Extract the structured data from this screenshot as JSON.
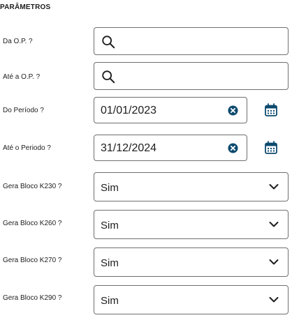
{
  "section": {
    "title": "PARÂMETROS"
  },
  "fields": [
    {
      "label": "Da O.P. ?",
      "type": "search",
      "value": ""
    },
    {
      "label": "Até a O.P. ?",
      "type": "search",
      "value": ""
    },
    {
      "label": "Do Período ?",
      "type": "date",
      "value": "01/01/2023"
    },
    {
      "label": "Até o Periodo ?",
      "type": "date",
      "value": "31/12/2024"
    },
    {
      "label": "Gera Bloco K230 ?",
      "type": "select",
      "value": "Sim"
    },
    {
      "label": "Gera Bloco K260 ?",
      "type": "select",
      "value": "Sim"
    },
    {
      "label": "Gera Bloco K270 ?",
      "type": "select",
      "value": "Sim"
    },
    {
      "label": "Gera Bloco K290 ?",
      "type": "select",
      "value": "Sim"
    }
  ],
  "icons": {
    "search": "search-icon",
    "clear": "clear-icon",
    "calendar": "calendar-icon",
    "chevron": "chevron-down-icon"
  },
  "colors": {
    "accent": "#0c4a6e",
    "border": "#6f6f6f",
    "text": "#1d1d1d"
  }
}
